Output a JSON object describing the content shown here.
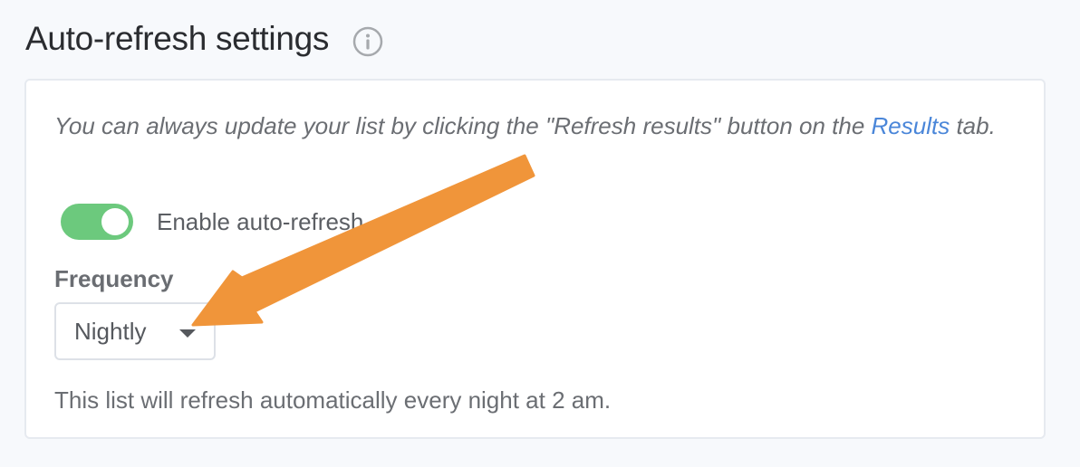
{
  "header": {
    "title": "Auto-refresh settings",
    "info_icon": "info-circle-icon"
  },
  "card": {
    "hint_before": "You can always update your list by clicking the \"Refresh results\" button on the ",
    "hint_link": "Results",
    "hint_after": " tab.",
    "toggle": {
      "label": "Enable auto-refresh",
      "enabled": true,
      "color": "#6cc97d"
    },
    "frequency": {
      "label": "Frequency",
      "selected": "Nightly",
      "icon": "caret-down-icon"
    },
    "note": "This list will refresh automatically every night at 2 am."
  },
  "annotation": {
    "type": "arrow",
    "color": "#f0953a"
  },
  "colors": {
    "link": "#4a86d9",
    "background": "#f7f9fc"
  }
}
